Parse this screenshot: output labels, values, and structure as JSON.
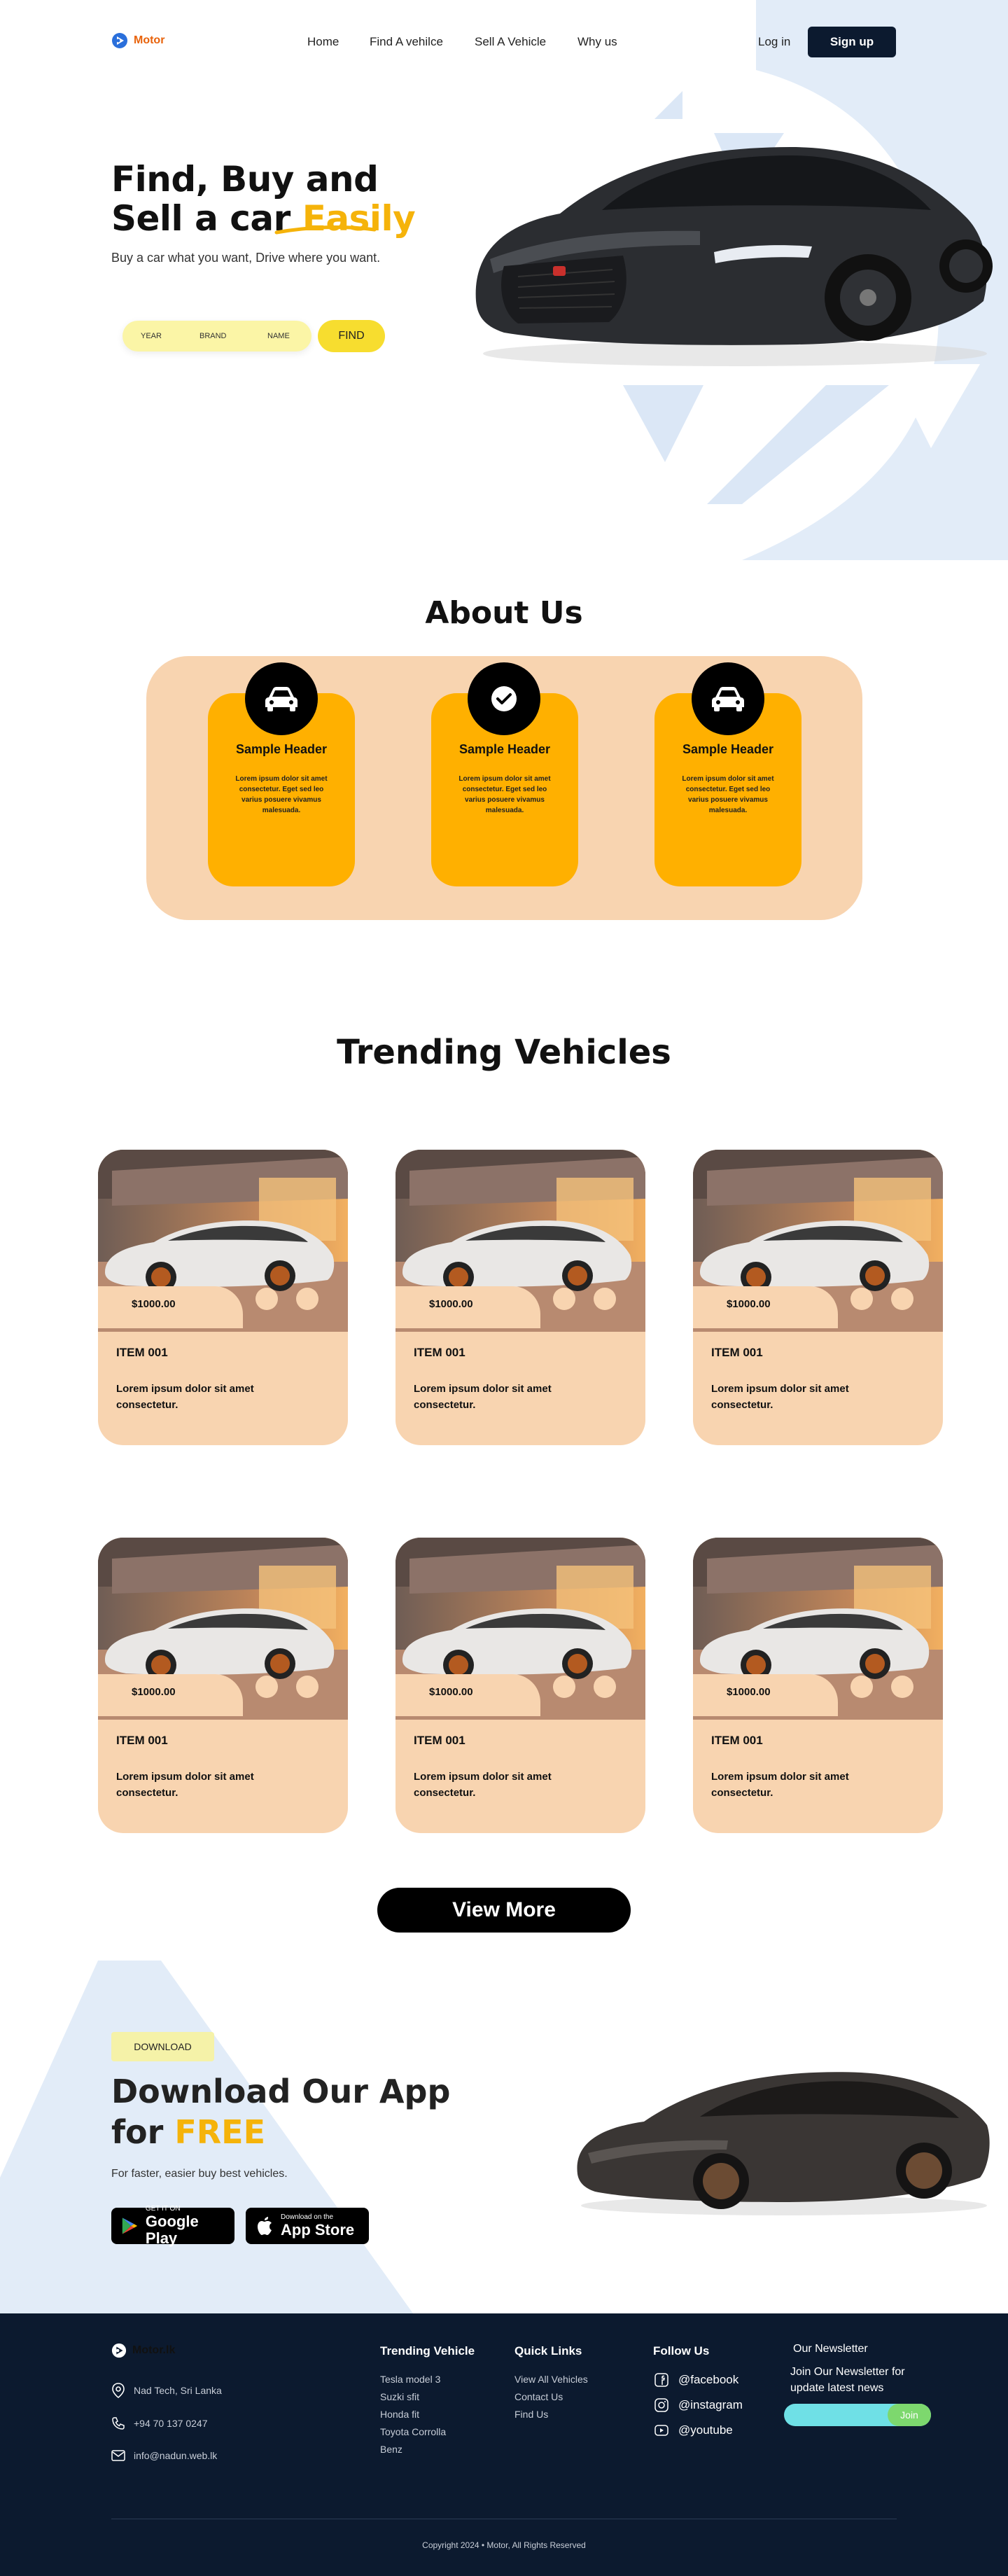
{
  "brand": {
    "name": "Motor",
    "accent": "#e8620a",
    "highlight": "#f5b30a",
    "navy": "#0c1a2f"
  },
  "nav": {
    "links": [
      "Home",
      "Find A vehilce",
      "Sell A Vehicle",
      "Why us"
    ],
    "login": "Log in",
    "signup": "Sign up"
  },
  "hero": {
    "title_line1": "Find, Buy and",
    "title_line2_prefix": "Sell a car ",
    "title_highlight": "Easily",
    "subtitle": "Buy a car what you want, Drive where you want.",
    "search_fields": [
      "YEAR",
      "BRAND",
      "NAME"
    ],
    "find_button": "FIND"
  },
  "about": {
    "title": "About Us",
    "cards": [
      {
        "icon": "car-icon",
        "header": "Sample Header",
        "text": "Lorem ipsum dolor sit amet consectetur. Eget sed leo varius posuere vivamus malesuada."
      },
      {
        "icon": "check-circle-icon",
        "header": "Sample Header",
        "text": "Lorem ipsum dolor sit amet consectetur. Eget sed leo varius posuere vivamus malesuada."
      },
      {
        "icon": "car-icon",
        "header": "Sample Header",
        "text": "Lorem ipsum dolor sit amet consectetur. Eget sed leo varius posuere vivamus malesuada."
      }
    ]
  },
  "trending": {
    "title": "Trending Vehicles",
    "items": [
      {
        "price": "$1000.00",
        "name": "ITEM 001",
        "desc": "Lorem ipsum dolor sit amet consectetur."
      },
      {
        "price": "$1000.00",
        "name": "ITEM 001",
        "desc": "Lorem ipsum dolor sit amet consectetur."
      },
      {
        "price": "$1000.00",
        "name": "ITEM 001",
        "desc": "Lorem ipsum dolor sit amet consectetur."
      },
      {
        "price": "$1000.00",
        "name": "ITEM 001",
        "desc": "Lorem ipsum dolor sit amet consectetur."
      },
      {
        "price": "$1000.00",
        "name": "ITEM 001",
        "desc": "Lorem ipsum dolor sit amet consectetur."
      },
      {
        "price": "$1000.00",
        "name": "ITEM 001",
        "desc": "Lorem ipsum dolor sit amet consectetur."
      }
    ],
    "view_more": "View More"
  },
  "download": {
    "badge": "DOWNLOAD",
    "title_line1": "Download Our App",
    "title_line2_prefix": "for ",
    "title_highlight": "FREE",
    "subtitle": "For faster, easier buy best vehicles.",
    "google_small": "GET IT ON",
    "google_big": "Google Play",
    "apple_small": "Download on the",
    "apple_big": "App Store"
  },
  "footer": {
    "brand": "Motor.lk",
    "address": "Nad Tech, Sri Lanka",
    "phone": "+94 70 137 0247",
    "email": "info@nadun.web.lk",
    "trending_head": "Trending Vehicle",
    "trending_items": [
      "Tesla model 3",
      "Suzki sfit",
      "Honda fit",
      "Toyota Corrolla",
      "Benz"
    ],
    "quick_head": "Quick Links",
    "quick_items": [
      "View All Vehicles",
      "Contact Us",
      "Find Us"
    ],
    "follow_head": "Follow Us",
    "socials": [
      {
        "icon": "facebook-icon",
        "label": "@facebook"
      },
      {
        "icon": "instagram-icon",
        "label": "@instagram"
      },
      {
        "icon": "youtube-icon",
        "label": "@youtube"
      }
    ],
    "newsletter_head": "Our Newsletter",
    "newsletter_text": "Join Our Newsletter for update latest news",
    "join": "Join",
    "copyright": "Copyright 2024  •  Motor, All Rights Reserved"
  }
}
